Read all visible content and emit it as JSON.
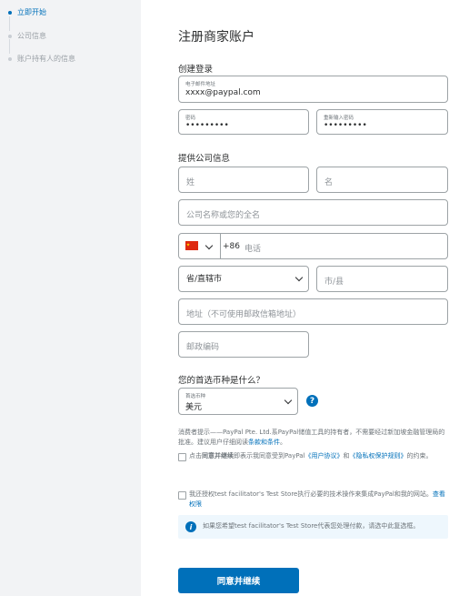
{
  "sidebar": {
    "steps": [
      {
        "label": "立即开始"
      },
      {
        "label": "公司信息"
      },
      {
        "label": "账户持有人的信息"
      }
    ]
  },
  "header": {
    "title": "注册商家账户"
  },
  "login": {
    "section_title": "创建登录",
    "email": {
      "label": "电子邮件地址",
      "value": "xxxx@paypal.com"
    },
    "password": {
      "label": "密码",
      "value": "•••••••••"
    },
    "confirm_password": {
      "label": "重新输入密码",
      "value": "•••••••••"
    }
  },
  "company": {
    "section_title": "提供公司信息",
    "last_name_placeholder": "姓",
    "first_name_placeholder": "名",
    "company_name_placeholder": "公司名称或您的全名",
    "phone": {
      "country_code": "+86",
      "placeholder": "电话"
    },
    "province_placeholder": "省/直辖市",
    "city_placeholder": "市/县",
    "address_placeholder": "地址（不可使用邮政信箱地址）",
    "postal_placeholder": "邮政编码"
  },
  "currency": {
    "question": "您的首选币种是什么？",
    "label": "首选币种",
    "value": "美元",
    "help_icon": "?"
  },
  "consumer_notice": {
    "text": "消费者提示——PayPal Pte. Ltd.系PayPal储值工具的持有者，不需要经过新加坡金融管理局的批准。建议用户仔细阅读",
    "link": "条款和条件",
    "end": "。"
  },
  "agreement": {
    "prefix": "点击",
    "bold": "同意并继续",
    "middle": "即表示我同意受到PayPal",
    "user_agreement": "《用户协议》",
    "and": "和",
    "privacy_policy": "《隐私权保护规则》",
    "suffix": "的约束。"
  },
  "authorize": {
    "text": "我还授权test facilitator's Test Store执行必要的技术操作来集成PayPal和我的网站。",
    "link": "查看权限"
  },
  "info_box": {
    "text": "如果您希望test facilitator's Test Store代表您处理付款，请选中此复选框。"
  },
  "submit": {
    "label": "同意并继续"
  },
  "colors": {
    "accent": "#0070ba",
    "sidebar_bg": "#f2f3f5",
    "info_bg": "#eef7fd"
  },
  "icons": {
    "flag": "china-flag-icon",
    "help": "help-icon",
    "info": "info-icon"
  }
}
